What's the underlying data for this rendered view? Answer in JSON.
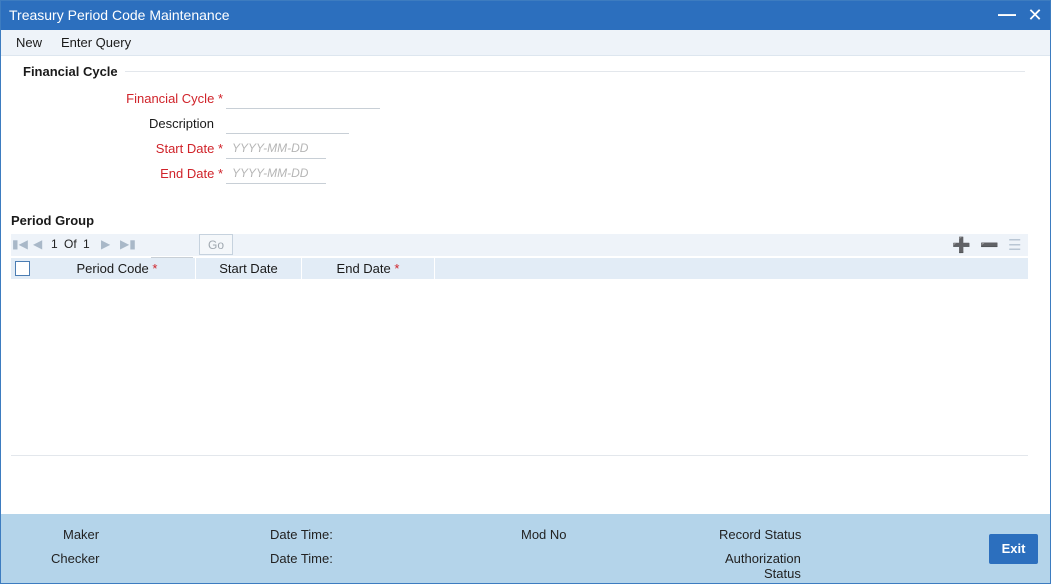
{
  "window": {
    "title": "Treasury Period Code Maintenance"
  },
  "menu": {
    "new": "New",
    "enter_query": "Enter Query"
  },
  "financial_cycle_section": {
    "heading": "Financial Cycle",
    "fields": {
      "financial_cycle": {
        "label": "Financial Cycle",
        "required": "*",
        "value": ""
      },
      "description": {
        "label": "Description",
        "value": ""
      },
      "start_date": {
        "label": "Start Date",
        "required": "*",
        "placeholder": "YYYY-MM-DD",
        "value": ""
      },
      "end_date": {
        "label": "End Date",
        "required": "*",
        "placeholder": "YYYY-MM-DD",
        "value": ""
      }
    }
  },
  "period_group": {
    "heading": "Period Group",
    "pagination": {
      "current": "1",
      "of": "Of",
      "total": "1",
      "go": "Go"
    },
    "columns": {
      "period_code": "Period Code",
      "start_date": "Start Date",
      "end_date": "End Date",
      "required": "*"
    },
    "rows": []
  },
  "footer": {
    "maker": "Maker",
    "checker": "Checker",
    "date_time_1": "Date Time:",
    "date_time_2": "Date Time:",
    "mod_no": "Mod No",
    "record_status": "Record Status",
    "authorization_status_1": "Authorization",
    "authorization_status_2": "Status",
    "exit": "Exit"
  },
  "colors": {
    "titlebar": "#2c6fbe",
    "required": "#d0232a",
    "footer": "#b4d4ea",
    "grid_header": "#e2ecf6"
  }
}
